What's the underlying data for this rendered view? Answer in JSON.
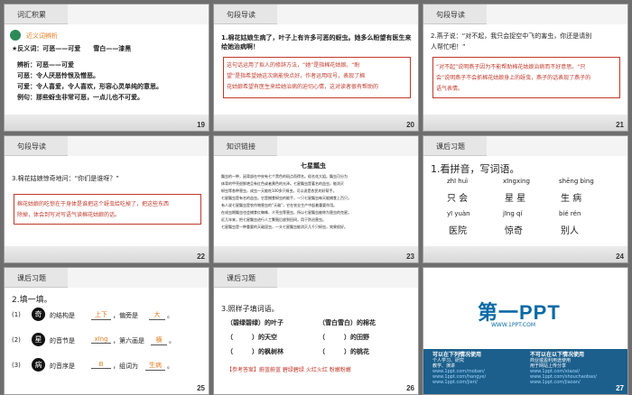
{
  "slides": [
    {
      "num": "19",
      "header": "词汇积累",
      "lines": [
        "近义词辨析",
        "★反义词：可恶——可爱　　雪白——漆黑",
        "辨析：可恶——可爱",
        "可恶：令人厌恶怜恨及憎恶。",
        "可爱：令人喜爱，令人喜欢，形容心灵单纯的意思。",
        "例句：那些蚜虫非常可恶，一点儿也不可爱。"
      ]
    },
    {
      "num": "20",
      "header": "句段导读",
      "lines": [
        "1.棉花姑娘生病了，叶子上有许多可恶的蚜虫。她多么盼望有医生来",
        "给她治病啊！",
        "这句话运用了拟人的修辞方法，“她”是指棉花姑娘。“盼",
        "望”是指希望她这次病能快点好，作者运用叹号，表现了棉",
        "花姑娘希望有医生来给她治病的迫切心情，这对读者很有帮助的"
      ]
    },
    {
      "num": "21",
      "header": "句段导读",
      "lines": [
        "2.燕子说：“对不起，我只会捉空中飞的害虫，你还是请别",
        "人帮忙吧！”",
        "“对不起”说明燕子因为不能帮助棉花姑娘治病而不好意思。“只",
        "会”说明燕子不会抓棉花姑娘身上的蚜虫，燕子的话表现了燕子的",
        "语气表情。"
      ]
    },
    {
      "num": "22",
      "header": "句段导读",
      "lines": [
        "3.棉花姑娘惊奇地问：“你们是谁呀？”",
        "棉花姑娘的吃惊在于身体是谁把这个蚜虫给吃掉了，把这些东西",
        "除掉，体会到写对写语气读棉花姑娘的话。"
      ]
    },
    {
      "num": "23",
      "header": "知识链接",
      "title": "七星瓢虫",
      "lines": [
        "瓢虫的一种，因背部在中央有七个黑色的斑点而得名。俗名花大姐。瓢虫可分为",
        "体背的甲壳很鲜艳且有红色或者黄色的光泽。七星瓢虫是著名的益虫，能消灭",
        "蚜虫等各种害虫，成虫一天能吃100多只蚜虫，可以说是农民的好帮手。",
        "七星瓢虫是有名的益虫，它是捕食蚜虫的能手，一只七星瓢虫每天能捕食上百只。",
        "有人说七星瓢虫是农作物害虫的“天敌”，它在农业生产中起着重要作用。",
        "在成虫期瓢虫也会捕食红蜘蛛、介壳虫等害虫，所以七星瓢虫被称为害虫的克星。",
        "近几年来，把七星瓢虫进行人工繁殖后放到田间，用于防治害虫。",
        "七星瓢虫是一种重要的天敌昆虫，一头七星瓢虫能消灭几千只蚜虫，效果很好。"
      ]
    },
    {
      "num": "24",
      "header": "课后习题",
      "title": "1.看拼音，写词语。",
      "pinyin": [
        "zhī huì",
        "xīngxing",
        "shēng bìng",
        "yī yuàn",
        "jīng qí",
        "bié rén"
      ],
      "words": [
        "只 会",
        "星 星",
        "生 病",
        "医院",
        "惊奇",
        "别人"
      ]
    },
    {
      "num": "25",
      "header": "课后习题",
      "title": "2.填一填。",
      "rows": [
        {
          "n": "(1)",
          "ch": "奇",
          "text": "的结构是",
          "ans1": "上下",
          "mid": "，偏旁是",
          "ans2": "大",
          "end": "。"
        },
        {
          "n": "(2)",
          "ch": "星",
          "text": "的音节是",
          "ans1": "xīng",
          "mid": "，第六画是",
          "ans2": "横",
          "end": "。"
        },
        {
          "n": "(3)",
          "ch": "病",
          "text": "的音序是",
          "ans1": "B",
          "mid": "，组词为",
          "ans2": "生病",
          "end": "。"
        }
      ]
    },
    {
      "num": "26",
      "header": "课后习题",
      "title": "3.照样子填词语。",
      "r1": [
        "（碧绿碧绿）的叶子",
        "（雪白雪白）的棉花"
      ],
      "r2": [
        "（　　　）的天空",
        "（　　　）的田野"
      ],
      "r3": [
        "（　　　）的枫树林",
        "（　　　）的桃花"
      ],
      "ans": "【参考答案】蔚蓝蔚蓝  碧绿碧绿  火红火红  粉嫩粉嫩"
    },
    {
      "num": "27",
      "header": "",
      "logo": "第一PPT",
      "url": "WWW.1PPT.COM",
      "left_title": "可以在下列情况使用",
      "left_lines": [
        "个人学习、研究",
        "教学、演讲",
        "",
        "www.1ppt.com/moban/",
        "www.1ppt.com/hangye/",
        "www.1ppt.com/jieri/",
        "www.1ppt.com/beijing/",
        "www.1ppt.com/ziliao/"
      ],
      "right_title": "不可以在以下情况使用",
      "right_lines": [
        "商业或盈利用途使用",
        "用于网站上传分享",
        "",
        "www.1ppt.com/xiazai/",
        "www.1ppt.com/shouchaobao/",
        "www.1ppt.com/jiaoan/",
        "www.1ppt.com/ziti/",
        "www.1ppt.com/word/"
      ]
    }
  ]
}
